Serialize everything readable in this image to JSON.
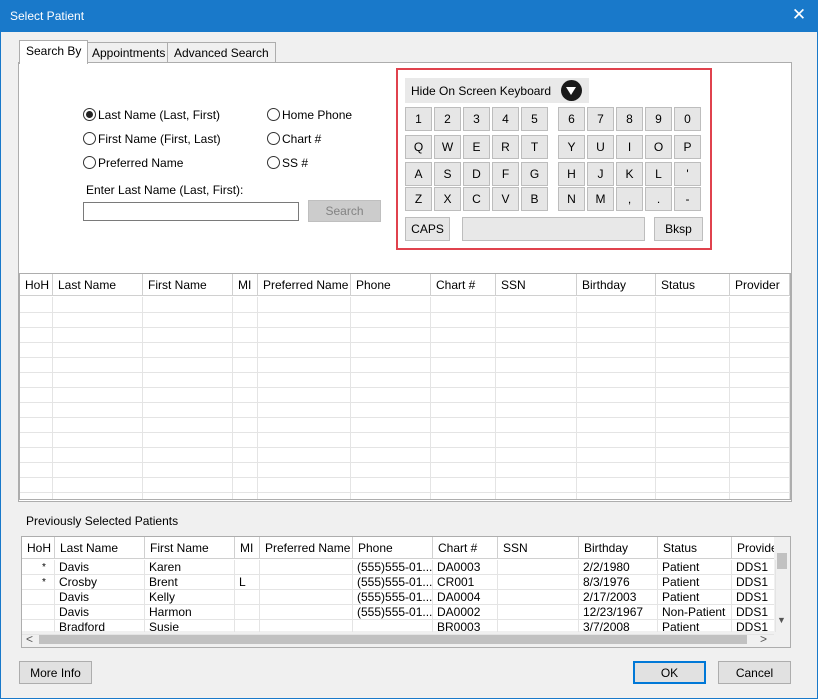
{
  "window": {
    "title": "Select Patient",
    "close_glyph": "✕"
  },
  "tabs": [
    {
      "label": "Search By",
      "active": true
    },
    {
      "label": "Appointments",
      "active": false
    },
    {
      "label": "Advanced Search",
      "active": false
    }
  ],
  "search_options": [
    {
      "label": "Last Name (Last, First)",
      "selected": true
    },
    {
      "label": "First Name (First, Last)",
      "selected": false
    },
    {
      "label": "Preferred Name",
      "selected": false
    },
    {
      "label": "Home Phone",
      "selected": false
    },
    {
      "label": "Chart #",
      "selected": false
    },
    {
      "label": "SS #",
      "selected": false
    }
  ],
  "search": {
    "prompt": "Enter Last Name (Last, First):",
    "value": "",
    "button": "Search"
  },
  "keyboard": {
    "hide_label": "Hide On Screen Keyboard",
    "rows": [
      [
        "1",
        "2",
        "3",
        "4",
        "5",
        "6",
        "7",
        "8",
        "9",
        "0"
      ],
      [
        "Q",
        "W",
        "E",
        "R",
        "T",
        "Y",
        "U",
        "I",
        "O",
        "P"
      ],
      [
        "A",
        "S",
        "D",
        "F",
        "G",
        "H",
        "J",
        "K",
        "L",
        "'"
      ],
      [
        "Z",
        "X",
        "C",
        "V",
        "B",
        "N",
        "M",
        ",",
        ".",
        "-"
      ]
    ],
    "caps": "CAPS",
    "space": "",
    "bksp": "Bksp"
  },
  "results_grid": {
    "columns": [
      "HoH",
      "Last Name",
      "First Name",
      "MI",
      "Preferred Name",
      "Phone",
      "Chart #",
      "SSN",
      "Birthday",
      "Status",
      "Provider"
    ]
  },
  "previous": {
    "label": "Previously Selected Patients",
    "columns": [
      "HoH",
      "Last Name",
      "First Name",
      "MI",
      "Preferred Name",
      "Phone",
      "Chart #",
      "SSN",
      "Birthday",
      "Status",
      "Provide"
    ],
    "rows": [
      {
        "hoh": "*",
        "last": "Davis",
        "first": "Karen",
        "mi": "",
        "pref": "",
        "phone": "(555)555-01...",
        "chart": "DA0003",
        "ssn": "",
        "birthday": "2/2/1980",
        "status": "Patient",
        "provider": "DDS1"
      },
      {
        "hoh": "*",
        "last": "Crosby",
        "first": "Brent",
        "mi": "L",
        "pref": "",
        "phone": "(555)555-01...",
        "chart": "CR001",
        "ssn": "",
        "birthday": "8/3/1976",
        "status": "Patient",
        "provider": "DDS1"
      },
      {
        "hoh": "",
        "last": "Davis",
        "first": "Kelly",
        "mi": "",
        "pref": "",
        "phone": "(555)555-01...",
        "chart": "DA0004",
        "ssn": "",
        "birthday": "2/17/2003",
        "status": "Patient",
        "provider": "DDS1"
      },
      {
        "hoh": "",
        "last": "Davis",
        "first": "Harmon",
        "mi": "",
        "pref": "",
        "phone": "(555)555-01...",
        "chart": "DA0002",
        "ssn": "",
        "birthday": "12/23/1967",
        "status": "Non-Patient",
        "provider": "DDS1"
      },
      {
        "hoh": "",
        "last": "Bradford",
        "first": "Susie",
        "mi": "",
        "pref": "",
        "phone": "",
        "chart": "BR0003",
        "ssn": "",
        "birthday": "3/7/2008",
        "status": "Patient",
        "provider": "DDS1"
      }
    ]
  },
  "buttons": {
    "more_info": "More Info",
    "ok": "OK",
    "cancel": "Cancel"
  },
  "scroll": {
    "up": "▲",
    "down": "▼",
    "left": "<",
    "right": ">"
  },
  "colors": {
    "titlebar": "#1979ca",
    "highlight_border": "#e0424d"
  }
}
